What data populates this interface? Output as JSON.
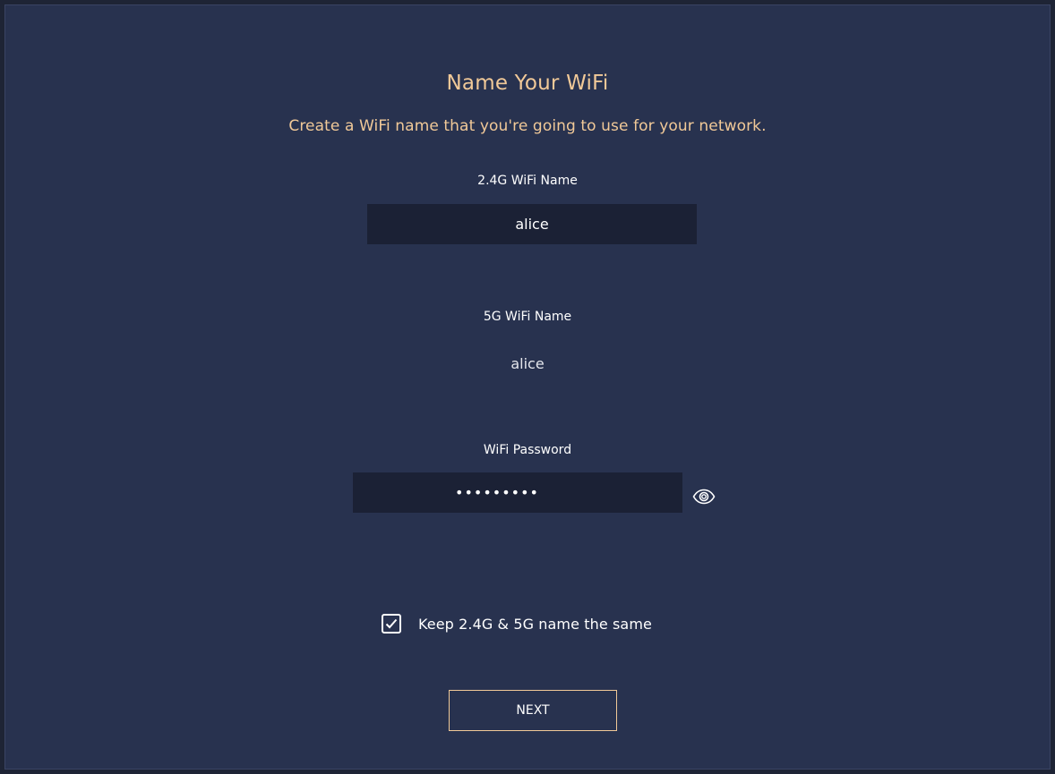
{
  "page": {
    "title": "Name Your WiFi",
    "subtitle": "Create a WiFi name that you're going to use for your network."
  },
  "wifi_24g": {
    "label": "2.4G WiFi Name",
    "value": "alice"
  },
  "wifi_5g": {
    "label": "5G WiFi Name",
    "value": "alice"
  },
  "password": {
    "label": "WiFi Password",
    "value": "•••••••••",
    "toggle_icon": "eye-icon"
  },
  "same_name": {
    "label": "Keep 2.4G & 5G name the same",
    "checked": true
  },
  "actions": {
    "next_label": "NEXT"
  },
  "colors": {
    "background": "#28324f",
    "accent": "#f1c998",
    "input_background": "#1b2135"
  }
}
